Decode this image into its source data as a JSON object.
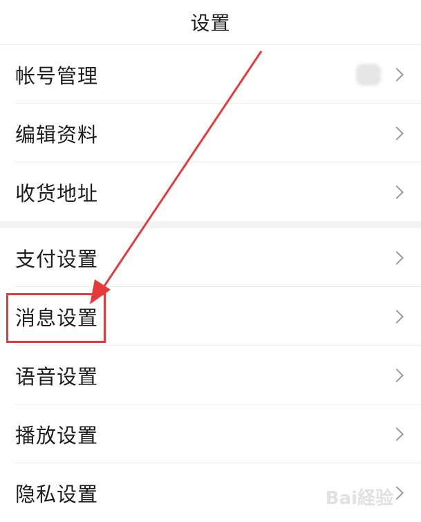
{
  "header": {
    "title": "设置"
  },
  "group1": [
    {
      "label": "帐号管理"
    },
    {
      "label": "编辑资料"
    },
    {
      "label": "收货地址"
    }
  ],
  "group2": [
    {
      "label": "支付设置"
    },
    {
      "label": "消息设置"
    },
    {
      "label": "语音设置"
    },
    {
      "label": "播放设置"
    },
    {
      "label": "隐私设置"
    }
  ],
  "watermark": "Bai経验",
  "colors": {
    "annotation": "#e53a3a"
  }
}
